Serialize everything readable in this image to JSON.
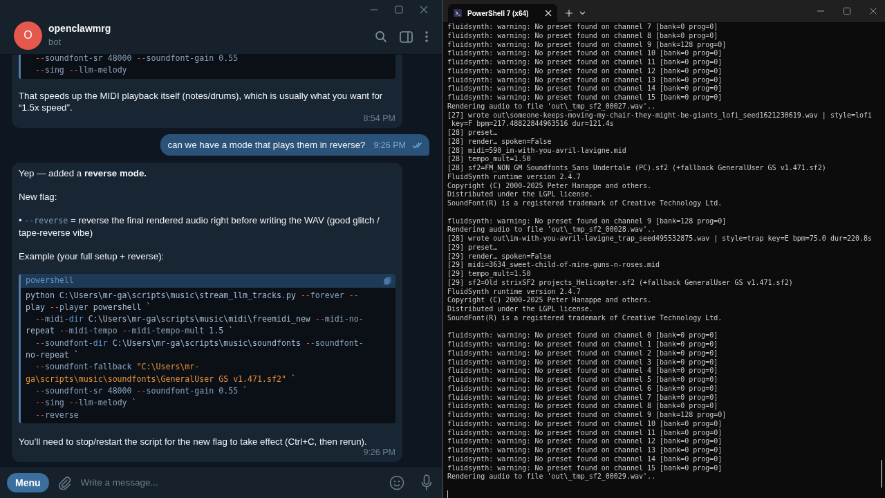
{
  "telegram": {
    "chat": {
      "avatar_letter": "O",
      "name": "openclawmrg",
      "status": "bot"
    },
    "messages": [
      {
        "kind": "incoming",
        "time": "8:54 PM",
        "blocks": [
          {
            "kind": "code",
            "lines": [
              {
                "indent": true,
                "tokens": [
                  {
                    "kind": "dash",
                    "text": "--"
                  },
                  {
                    "kind": "flag",
                    "text": "soundfont-sr 48000 "
                  },
                  {
                    "kind": "dash",
                    "text": "--"
                  },
                  {
                    "kind": "flag",
                    "text": "soundfont-gain 0.55"
                  }
                ]
              },
              {
                "indent": true,
                "tokens": [
                  {
                    "kind": "dash",
                    "text": "--"
                  },
                  {
                    "kind": "flag",
                    "text": "sing "
                  },
                  {
                    "kind": "dash",
                    "text": "--"
                  },
                  {
                    "kind": "flag",
                    "text": "llm-melody"
                  }
                ]
              }
            ]
          },
          {
            "kind": "text",
            "text": "That speeds up the MIDI playback itself (notes/drums), which is usually what you want for “1.5x speed”."
          }
        ]
      },
      {
        "kind": "outgoing",
        "time": "9:26 PM",
        "read": true,
        "blocks": [
          {
            "kind": "text",
            "text": "can we have a mode that plays them in reverse?"
          }
        ]
      },
      {
        "kind": "incoming",
        "time": "9:26 PM",
        "blocks": [
          {
            "kind": "text",
            "text": "Yep — added a **reverse mode.**"
          },
          {
            "kind": "text",
            "text": "New flag:"
          },
          {
            "kind": "bullet",
            "marker": "•",
            "code": "--reverse",
            "text": " = reverse the final rendered audio right before writing the WAV (good glitch / tape-reverse vibe)"
          },
          {
            "kind": "text",
            "text": "Example (your full setup + reverse):"
          },
          {
            "kind": "code",
            "language": "powershell",
            "lines": [
              {
                "indent": false,
                "tokens": [
                  {
                    "kind": "plain",
                    "text": "python C:\\Users\\mr-ga\\scripts\\music\\stream_llm_tracks"
                  },
                  {
                    "kind": "op",
                    "text": "."
                  },
                  {
                    "kind": "plain",
                    "text": "py "
                  },
                  {
                    "kind": "dash",
                    "text": "--"
                  },
                  {
                    "kind": "flag",
                    "text": "forever "
                  },
                  {
                    "kind": "dash",
                    "text": "--"
                  }
                ]
              },
              {
                "indent": false,
                "tokens": [
                  {
                    "kind": "plain",
                    "text": "play "
                  },
                  {
                    "kind": "dash",
                    "text": "--"
                  },
                  {
                    "kind": "flag",
                    "text": "player "
                  },
                  {
                    "kind": "plain",
                    "text": "powershell `"
                  }
                ]
              },
              {
                "indent": true,
                "tokens": [
                  {
                    "kind": "dash",
                    "text": "--"
                  },
                  {
                    "kind": "flag",
                    "text": "midi-"
                  },
                  {
                    "kind": "keyword",
                    "text": "dir"
                  },
                  {
                    "kind": "plain",
                    "text": " C:\\Users\\mr-ga\\scripts\\music\\midi\\freemidi_new "
                  },
                  {
                    "kind": "dash",
                    "text": "--"
                  },
                  {
                    "kind": "flag",
                    "text": "midi-no-"
                  }
                ]
              },
              {
                "indent": false,
                "tokens": [
                  {
                    "kind": "plain",
                    "text": "repeat "
                  },
                  {
                    "kind": "dash",
                    "text": "--"
                  },
                  {
                    "kind": "flag",
                    "text": "midi-tempo "
                  },
                  {
                    "kind": "dash",
                    "text": "--"
                  },
                  {
                    "kind": "flag",
                    "text": "midi-tempo-mult "
                  },
                  {
                    "kind": "plain",
                    "text": "1.5 `"
                  }
                ]
              },
              {
                "indent": true,
                "tokens": [
                  {
                    "kind": "dash",
                    "text": "--"
                  },
                  {
                    "kind": "flag",
                    "text": "soundfont-"
                  },
                  {
                    "kind": "keyword",
                    "text": "dir"
                  },
                  {
                    "kind": "plain",
                    "text": " C:\\Users\\mr-ga\\scripts\\music\\soundfonts "
                  },
                  {
                    "kind": "dash",
                    "text": "--"
                  },
                  {
                    "kind": "flag",
                    "text": "soundfont-"
                  }
                ]
              },
              {
                "indent": false,
                "tokens": [
                  {
                    "kind": "plain",
                    "text": "no-repeat `"
                  }
                ]
              },
              {
                "indent": true,
                "tokens": [
                  {
                    "kind": "dash",
                    "text": "--"
                  },
                  {
                    "kind": "flag",
                    "text": "soundfont-fallback "
                  },
                  {
                    "kind": "string",
                    "text": "\"C:\\Users\\mr-"
                  }
                ]
              },
              {
                "indent": false,
                "tokens": [
                  {
                    "kind": "string",
                    "text": "ga\\scripts\\music\\soundfonts\\GeneralUser GS v1.471.sf2\""
                  },
                  {
                    "kind": "plain",
                    "text": " `"
                  }
                ]
              },
              {
                "indent": true,
                "tokens": [
                  {
                    "kind": "dash",
                    "text": "--"
                  },
                  {
                    "kind": "flag",
                    "text": "soundfont-sr 48000 "
                  },
                  {
                    "kind": "dash",
                    "text": "--"
                  },
                  {
                    "kind": "flag",
                    "text": "soundfont-gain 0.55 `"
                  }
                ]
              },
              {
                "indent": true,
                "tokens": [
                  {
                    "kind": "dash",
                    "text": "--"
                  },
                  {
                    "kind": "flag",
                    "text": "sing "
                  },
                  {
                    "kind": "dash",
                    "text": "--"
                  },
                  {
                    "kind": "flag",
                    "text": "llm-melody `"
                  }
                ]
              },
              {
                "indent": true,
                "tokens": [
                  {
                    "kind": "dash",
                    "text": "--"
                  },
                  {
                    "kind": "flag",
                    "text": "reverse"
                  }
                ]
              }
            ]
          },
          {
            "kind": "text",
            "text": "You’ll need to stop/restart the script for the new flag to take effect (Ctrl+C, then rerun)."
          }
        ]
      }
    ],
    "composer": {
      "menu_button": "Menu",
      "placeholder": "Write a message..."
    }
  },
  "terminal": {
    "tab_title": "PowerShell 7 (x64)",
    "output_blocks": [
      [
        "fluidsynth: warning: No preset found on channel 7 [bank=0 prog=0]",
        "fluidsynth: warning: No preset found on channel 8 [bank=0 prog=0]",
        "fluidsynth: warning: No preset found on channel 9 [bank=128 prog=0]",
        "fluidsynth: warning: No preset found on channel 10 [bank=0 prog=0]",
        "fluidsynth: warning: No preset found on channel 11 [bank=0 prog=0]",
        "fluidsynth: warning: No preset found on channel 12 [bank=0 prog=0]",
        "fluidsynth: warning: No preset found on channel 13 [bank=0 prog=0]",
        "fluidsynth: warning: No preset found on channel 14 [bank=0 prog=0]",
        "fluidsynth: warning: No preset found on channel 15 [bank=0 prog=0]",
        "Rendering audio to file 'out\\_tmp_sf2_00027.wav'..",
        "[27] wrote out\\someone-keeps-moving-my-chair-they-might-be-giants_lofi_seed1621230619.wav | style=lofi",
        " key=F bpm=217.48822844963516 dur=121.4s",
        "[28] preset…",
        "[28] render… spoken=False",
        "[28] midi=590_im-with-you-avril-lavigne.mid",
        "[28] tempo_mult=1.50",
        "[28] sf2=FM_NON GM Soundfonts_Sans Undertale (PC).sf2 (+fallback GeneralUser GS v1.471.sf2)",
        "FluidSynth runtime version 2.4.7",
        "Copyright (C) 2000-2025 Peter Hanappe and others.",
        "Distributed under the LGPL license.",
        "SoundFont(R) is a registered trademark of Creative Technology Ltd."
      ],
      [
        "fluidsynth: warning: No preset found on channel 9 [bank=128 prog=0]",
        "Rendering audio to file 'out\\_tmp_sf2_00028.wav'..",
        "[28] wrote out\\im-with-you-avril-lavigne_trap_seed495532875.wav | style=trap key=E bpm=75.0 dur=220.8s",
        "[29] preset…",
        "[29] render… spoken=False",
        "[29] midi=3634_sweet-child-of-mine-guns-n-roses.mid",
        "[29] tempo_mult=1.50",
        "[29] sf2=Old strixSF2 projects_Helicopter.sf2 (+fallback GeneralUser GS v1.471.sf2)",
        "FluidSynth runtime version 2.4.7",
        "Copyright (C) 2000-2025 Peter Hanappe and others.",
        "Distributed under the LGPL license.",
        "SoundFont(R) is a registered trademark of Creative Technology Ltd."
      ],
      [
        "fluidsynth: warning: No preset found on channel 0 [bank=0 prog=0]",
        "fluidsynth: warning: No preset found on channel 1 [bank=0 prog=0]",
        "fluidsynth: warning: No preset found on channel 2 [bank=0 prog=0]",
        "fluidsynth: warning: No preset found on channel 3 [bank=0 prog=0]",
        "fluidsynth: warning: No preset found on channel 4 [bank=0 prog=0]",
        "fluidsynth: warning: No preset found on channel 5 [bank=0 prog=0]",
        "fluidsynth: warning: No preset found on channel 6 [bank=0 prog=0]",
        "fluidsynth: warning: No preset found on channel 7 [bank=0 prog=0]",
        "fluidsynth: warning: No preset found on channel 8 [bank=0 prog=0]",
        "fluidsynth: warning: No preset found on channel 9 [bank=128 prog=0]",
        "fluidsynth: warning: No preset found on channel 10 [bank=0 prog=0]",
        "fluidsynth: warning: No preset found on channel 11 [bank=0 prog=0]",
        "fluidsynth: warning: No preset found on channel 12 [bank=0 prog=0]",
        "fluidsynth: warning: No preset found on channel 13 [bank=0 prog=0]",
        "fluidsynth: warning: No preset found on channel 14 [bank=0 prog=0]",
        "fluidsynth: warning: No preset found on channel 15 [bank=0 prog=0]",
        "Rendering audio to file 'out\\_tmp_sf2_00029.wav'.."
      ]
    ]
  }
}
